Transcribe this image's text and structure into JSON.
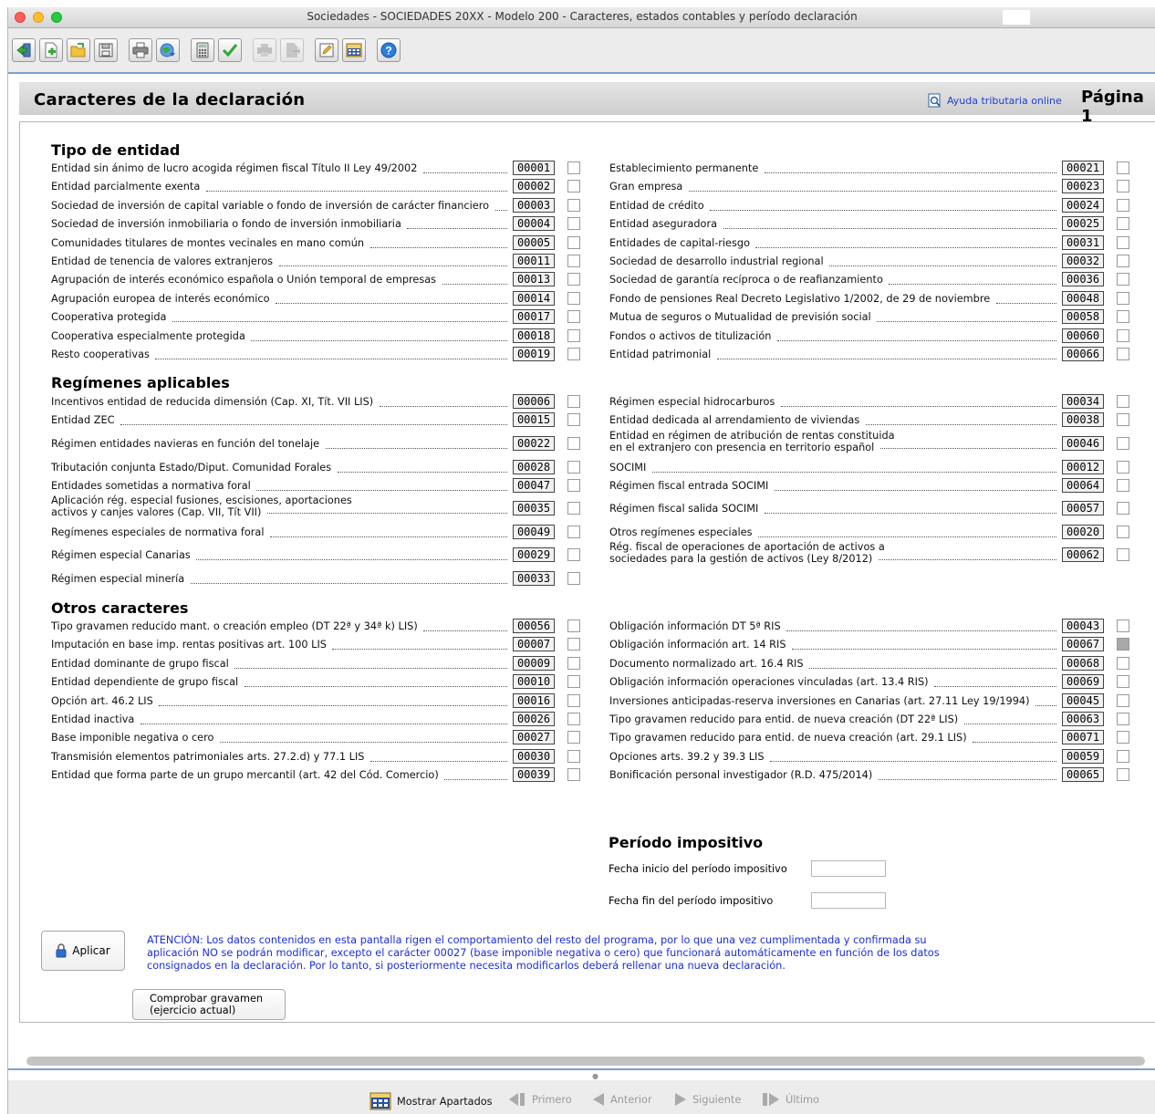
{
  "window": {
    "title": "Sociedades - SOCIEDADES 20XX - Modelo 200 - Caracteres, estados contables y período declaración"
  },
  "toolbar": {
    "buttons": [
      "exit-icon",
      "new-icon",
      "open-folder-icon",
      "save-icon",
      "print-icon",
      "send-globe-icon",
      "calculator-icon",
      "validate-check-icon",
      "print-gray-icon",
      "export-gray-icon",
      "edit-pencil-icon",
      "apartados-icon",
      "help-icon"
    ]
  },
  "header": {
    "title": "Caracteres de la declaración",
    "help_link": "Ayuda tributaria online",
    "page": "Página 1"
  },
  "sections": {
    "tipo_entidad": {
      "title": "Tipo de entidad",
      "left": [
        {
          "label": "Entidad sin ánimo de lucro acogida régimen fiscal Título II Ley 49/2002",
          "code": "00001",
          "checked": false
        },
        {
          "label": "Entidad parcialmente exenta",
          "code": "00002",
          "checked": false
        },
        {
          "label": "Sociedad de inversión de capital variable o fondo de inversión de carácter financiero",
          "code": "00003",
          "checked": false
        },
        {
          "label": "Sociedad de inversión inmobiliaria o fondo de inversión inmobiliaria",
          "code": "00004",
          "checked": false
        },
        {
          "label": "Comunidades titulares de montes vecinales en mano común",
          "code": "00005",
          "checked": false
        },
        {
          "label": "Entidad de tenencia de valores extranjeros",
          "code": "00011",
          "checked": false
        },
        {
          "label": "Agrupación de interés económico española o Unión temporal de empresas",
          "code": "00013",
          "checked": false
        },
        {
          "label": "Agrupación europea de interés económico",
          "code": "00014",
          "checked": false
        },
        {
          "label": "Cooperativa protegida",
          "code": "00017",
          "checked": false
        },
        {
          "label": "Cooperativa especialmente protegida",
          "code": "00018",
          "checked": false
        },
        {
          "label": "Resto cooperativas",
          "code": "00019",
          "checked": false
        }
      ],
      "right": [
        {
          "label": "Establecimiento permanente",
          "code": "00021",
          "checked": false
        },
        {
          "label": "Gran empresa",
          "code": "00023",
          "checked": false
        },
        {
          "label": "Entidad de crédito",
          "code": "00024",
          "checked": false
        },
        {
          "label": "Entidad aseguradora",
          "code": "00025",
          "checked": false
        },
        {
          "label": "Entidades de capital-riesgo",
          "code": "00031",
          "checked": false
        },
        {
          "label": "Sociedad de desarrollo industrial regional",
          "code": "00032",
          "checked": false
        },
        {
          "label": "Sociedad de garantía recíproca o de reafianzamiento",
          "code": "00036",
          "checked": false
        },
        {
          "label": "Fondo de pensiones Real Decreto Legislativo 1/2002, de 29 de noviembre",
          "code": "00048",
          "checked": false
        },
        {
          "label": "Mutua de seguros o Mutualidad de previsión social",
          "code": "00058",
          "checked": false
        },
        {
          "label": "Fondos o activos de titulización",
          "code": "00060",
          "checked": false
        },
        {
          "label": "Entidad patrimonial",
          "code": "00066",
          "checked": false
        }
      ]
    },
    "regimenes": {
      "title": "Regímenes aplicables",
      "left": [
        {
          "label": "Incentivos entidad de reducida dimensión (Cap. XI, Tít. VII LIS)",
          "code": "00006",
          "checked": false
        },
        {
          "label": "Entidad ZEC",
          "code": "00015",
          "checked": false
        },
        {
          "label": "Régimen entidades navieras en función del tonelaje",
          "code": "00022",
          "checked": false
        },
        {
          "label": "Tributación conjunta Estado/Diput. Comunidad Forales",
          "code": "00028",
          "checked": false
        },
        {
          "label": "Entidades sometidas a normativa foral",
          "code": "00047",
          "checked": false
        },
        {
          "label": "Aplicación rég. especial fusiones, escisiones, aportaciones\nactivos y canjes valores (Cap. VII, Tít VII)",
          "code": "00035",
          "checked": false
        },
        {
          "label": "Regímenes especiales de normativa foral",
          "code": "00049",
          "checked": false
        },
        {
          "label": "Régimen especial Canarias",
          "code": "00029",
          "checked": false
        },
        {
          "label": "Régimen especial minería",
          "code": "00033",
          "checked": false
        }
      ],
      "right": [
        {
          "label": "Régimen especial hidrocarburos",
          "code": "00034",
          "checked": false
        },
        {
          "label": "Entidad dedicada al arrendamiento de viviendas",
          "code": "00038",
          "checked": false
        },
        {
          "label": "Entidad en régimen de atribución de rentas constituida\nen el extranjero con presencia en territorio español",
          "code": "00046",
          "checked": false
        },
        {
          "label": "SOCIMI",
          "code": "00012",
          "checked": false
        },
        {
          "label": "Régimen fiscal entrada SOCIMI",
          "code": "00064",
          "checked": false
        },
        {
          "label": "Régimen fiscal salida SOCIMI",
          "code": "00057",
          "checked": false
        },
        {
          "label": "Otros regímenes especiales",
          "code": "00020",
          "checked": false
        },
        {
          "label": "Rég. fiscal de operaciones de aportación de activos a\nsociedades para la gestión de activos (Ley 8/2012)",
          "code": "00062",
          "checked": false
        }
      ]
    },
    "otros": {
      "title": "Otros caracteres",
      "left": [
        {
          "label": "Tipo gravamen reducido mant. o creación empleo (DT 22ª y 34ª k) LIS)",
          "code": "00056",
          "checked": false
        },
        {
          "label": "Imputación en base imp. rentas positivas art. 100 LIS",
          "code": "00007",
          "checked": false
        },
        {
          "label": "Entidad dominante de grupo fiscal",
          "code": "00009",
          "checked": false
        },
        {
          "label": "Entidad dependiente de grupo fiscal",
          "code": "00010",
          "checked": false
        },
        {
          "label": "Opción art. 46.2 LIS",
          "code": "00016",
          "checked": false
        },
        {
          "label": "Entidad inactiva",
          "code": "00026",
          "checked": false
        },
        {
          "label": "Base imponible negativa o cero",
          "code": "00027",
          "checked": false
        },
        {
          "label": "Transmisión elementos patrimoniales arts. 27.2.d) y 77.1 LIS",
          "code": "00030",
          "checked": false
        },
        {
          "label": "Entidad que forma parte de un grupo mercantil (art. 42 del Cód. Comercio)",
          "code": "00039",
          "checked": false
        }
      ],
      "right": [
        {
          "label": "Obligación información DT 5ª RIS",
          "code": "00043",
          "checked": false
        },
        {
          "label": "Obligación información art. 14 RIS",
          "code": "00067",
          "checked": true
        },
        {
          "label": "Documento normalizado art. 16.4 RIS",
          "code": "00068",
          "checked": false
        },
        {
          "label": "Obligación información operaciones vinculadas (art. 13.4 RIS)",
          "code": "00069",
          "checked": false
        },
        {
          "label": "Inversiones anticipadas-reserva inversiones en Canarias (art. 27.11 Ley 19/1994)",
          "code": "00045",
          "checked": false
        },
        {
          "label": "Tipo gravamen reducido para entid. de nueva creación (DT 22ª LIS)",
          "code": "00063",
          "checked": false
        },
        {
          "label": "Tipo gravamen reducido para entid. de nueva creación (art. 29.1 LIS)",
          "code": "00071",
          "checked": false
        },
        {
          "label": "Opciones arts. 39.2 y 39.3 LIS",
          "code": "00059",
          "checked": false
        },
        {
          "label": "Bonificación personal investigador (R.D. 475/2014)",
          "code": "00065",
          "checked": false
        }
      ]
    }
  },
  "periodo": {
    "title": "Período impositivo",
    "inicio_label": "Fecha inicio del período impositivo",
    "inicio_value": "",
    "fin_label": "Fecha fin del período impositivo",
    "fin_value": ""
  },
  "actions": {
    "aplicar": "Aplicar",
    "atencion": "ATENCIÓN: Los datos contenidos en esta pantalla rigen el comportamiento del resto del programa, por lo que una vez cumplimentada y confirmada su aplicación NO se podrán modificar, excepto el carácter 00027 (base imponible negativa o cero) que funcionará automáticamente en función de los datos consignados en la declaración. Por lo tanto, si posteriormente necesita modificarlos deberá rellenar una nueva declaración.",
    "comprobar": "Comprobar gravamen\n(ejercicio actual)"
  },
  "bottom": {
    "mostrar": "Mostrar Apartados",
    "primero": "Primero",
    "anterior": "Anterior",
    "siguiente": "Siguiente",
    "ultimo": "Último"
  }
}
